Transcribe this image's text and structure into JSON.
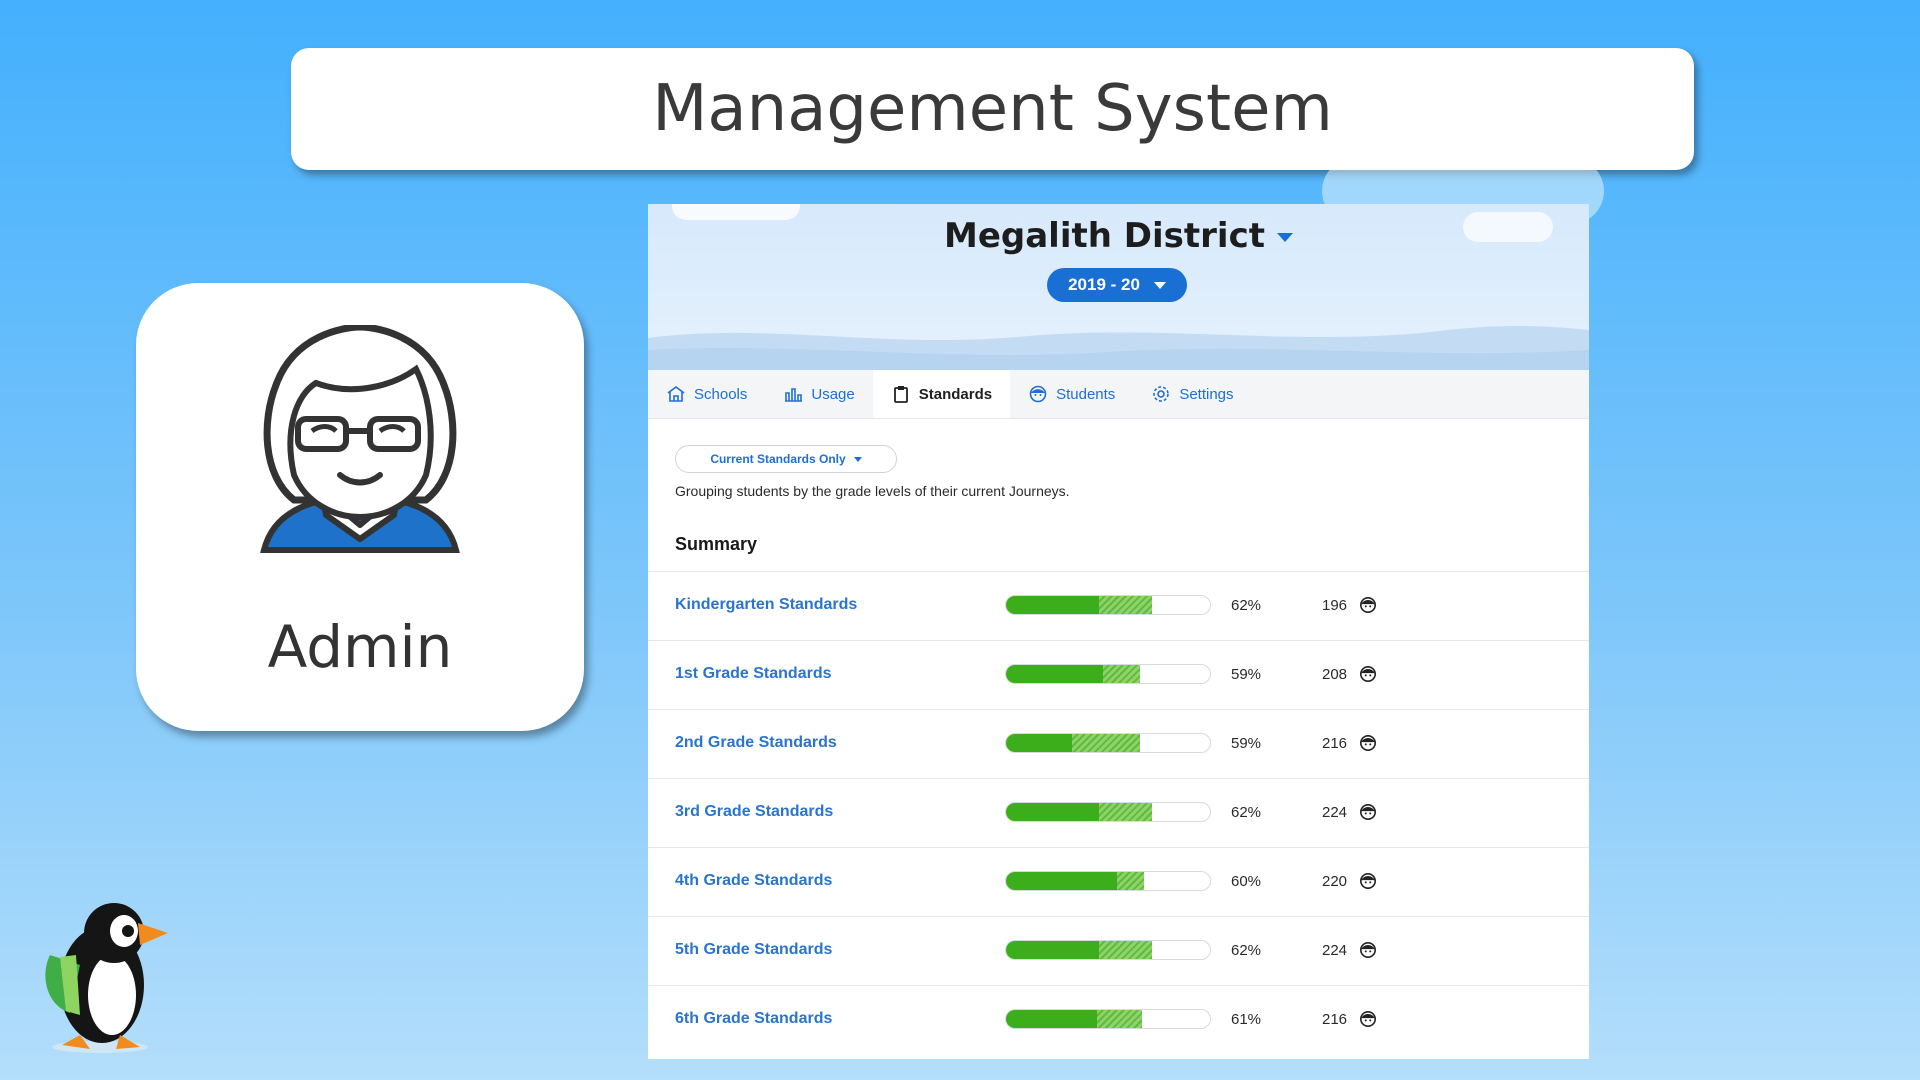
{
  "banner": {
    "title": "Management System"
  },
  "role_card": {
    "label": "Admin",
    "avatar_icon": "admin-woman-avatar-icon"
  },
  "mascot": {
    "icon": "penguin-mascot-icon"
  },
  "app": {
    "district_name": "Megalith District",
    "year": "2019 - 20",
    "tabs": [
      {
        "label": "Schools",
        "icon": "school-icon",
        "active": false
      },
      {
        "label": "Usage",
        "icon": "bar-chart-icon",
        "active": false
      },
      {
        "label": "Standards",
        "icon": "clipboard-icon",
        "active": true
      },
      {
        "label": "Students",
        "icon": "student-face-icon",
        "active": false
      },
      {
        "label": "Settings",
        "icon": "gear-icon",
        "active": false
      }
    ],
    "filter_label": "Current Standards Only",
    "description": "Grouping students by the grade levels of their current Journeys.",
    "summary_title": "Summary",
    "rows": [
      {
        "label": "Kindergarten Standards",
        "percent": "62%",
        "count": "196",
        "solid": 0.45,
        "hatched": 0.26
      },
      {
        "label": "1st Grade Standards",
        "percent": "59%",
        "count": "208",
        "solid": 0.47,
        "hatched": 0.18
      },
      {
        "label": "2nd Grade Standards",
        "percent": "59%",
        "count": "216",
        "solid": 0.32,
        "hatched": 0.33
      },
      {
        "label": "3rd Grade Standards",
        "percent": "62%",
        "count": "224",
        "solid": 0.45,
        "hatched": 0.26
      },
      {
        "label": "4th Grade Standards",
        "percent": "60%",
        "count": "220",
        "solid": 0.54,
        "hatched": 0.13
      },
      {
        "label": "5th Grade Standards",
        "percent": "62%",
        "count": "224",
        "solid": 0.45,
        "hatched": 0.26
      },
      {
        "label": "6th Grade Standards",
        "percent": "61%",
        "count": "216",
        "solid": 0.44,
        "hatched": 0.22
      }
    ],
    "colors": {
      "accent": "#1a6fd5",
      "bar_solid": "#3cae1c",
      "bar_hatch": "#8fd26b"
    }
  }
}
